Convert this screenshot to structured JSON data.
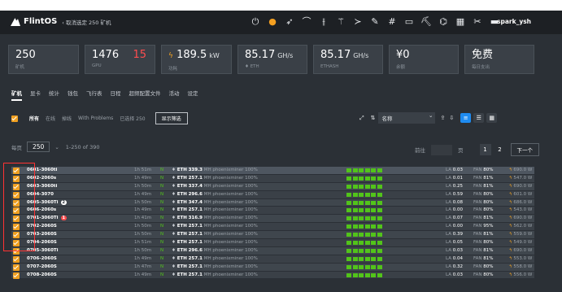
{
  "app": {
    "name": "FlintOS",
    "back": "‹ 取消选定 250 矿机",
    "user": "spark_ysh"
  },
  "topbar_icons": [
    "power-icon",
    "orange-icon",
    "rocket-icon",
    "gauge-icon",
    "sliders-icon",
    "wand-icon",
    "terminal-icon",
    "brush-icon",
    "hash-icon",
    "monitor-icon",
    "pick-icon",
    "usb-icon",
    "chip-icon",
    "tools-icon",
    "minus-box-icon"
  ],
  "stats": [
    {
      "value": "250",
      "label": "矿机",
      "unit": "",
      "extra": ""
    },
    {
      "value": "1476",
      "label": "GPU",
      "unit": "",
      "extra": "15"
    },
    {
      "value": "189.5",
      "label": "功耗",
      "unit": "kW",
      "extra": ""
    },
    {
      "value": "85.17",
      "label": "ETH",
      "unit": "GH/s",
      "extra": ""
    },
    {
      "value": "85.17",
      "label": "ETHASH",
      "unit": "GH/s",
      "extra": ""
    },
    {
      "value": "¥0",
      "label": "余额",
      "unit": "",
      "extra": ""
    },
    {
      "value": "免费",
      "label": "每日支出",
      "unit": "",
      "extra": ""
    }
  ],
  "tabs": [
    "矿机",
    "显卡",
    "统计",
    "钱包",
    "飞行表",
    "日程",
    "超频配置文件",
    "活动",
    "设定"
  ],
  "filters": {
    "all": "所有",
    "online": "在线",
    "offline": "掉线",
    "problems": "With Problems",
    "selected": "已选择 250",
    "show_button": "显示筛选"
  },
  "sort": {
    "value": "名称"
  },
  "pager": {
    "per_page_label": "每页",
    "per_page": "250",
    "range": "1-250 of 390",
    "goto": "前往",
    "page_suffix": "页",
    "pages": [
      "1",
      "2"
    ],
    "next": "下一个"
  },
  "rows": [
    {
      "name": "0601-3060ti",
      "badge": "",
      "uptime": "1h 51m",
      "status": "N",
      "coin": "ETH",
      "hashrate": "339.3",
      "unit": "MH",
      "miner": "phoenixminer",
      "pct": "100%",
      "la": "0.03",
      "fan": "80%",
      "power": "690.0 W"
    },
    {
      "name": "0602-2060s",
      "badge": "",
      "uptime": "1h 49m",
      "status": "N",
      "coin": "ETH",
      "hashrate": "257.1",
      "unit": "MH",
      "miner": "phoenixminer",
      "pct": "100%",
      "la": "0.01",
      "fan": "81%",
      "power": "547.0 W"
    },
    {
      "name": "0603-3060ti",
      "badge": "",
      "uptime": "1h 50m",
      "status": "N",
      "coin": "ETH",
      "hashrate": "337.4",
      "unit": "MH",
      "miner": "phoenixminer",
      "pct": "100%",
      "la": "0.25",
      "fan": "81%",
      "power": "690.0 W"
    },
    {
      "name": "0604-3070",
      "badge": "",
      "uptime": "1h 49m",
      "status": "N",
      "coin": "ETH",
      "hashrate": "296.6",
      "unit": "MH",
      "miner": "phoenixminer",
      "pct": "100%",
      "la": "0.59",
      "fan": "80%",
      "power": "601.0 W"
    },
    {
      "name": "0605-3060Ti",
      "badge": "2",
      "uptime": "1h 50m",
      "status": "N",
      "coin": "ETH",
      "hashrate": "347.4",
      "unit": "MH",
      "miner": "phoenixminer",
      "pct": "100%",
      "la": "0.08",
      "fan": "80%",
      "power": "686.0 W"
    },
    {
      "name": "0606-2060s",
      "badge": "",
      "uptime": "1h 49m",
      "status": "N",
      "coin": "ETH",
      "hashrate": "257.1",
      "unit": "MH",
      "miner": "phoenixminer",
      "pct": "100%",
      "la": "0.00",
      "fan": "80%",
      "power": "543.0 W"
    },
    {
      "name": "0701-3060Ti",
      "badge": "1",
      "uptime": "1h 41m",
      "status": "N",
      "coin": "ETH",
      "hashrate": "316.9",
      "unit": "MH",
      "miner": "phoenixminer",
      "pct": "100%",
      "la": "0.07",
      "fan": "81%",
      "power": "690.0 W"
    },
    {
      "name": "0702-2060S",
      "badge": "",
      "uptime": "1h 50m",
      "status": "N",
      "coin": "ETH",
      "hashrate": "257.1",
      "unit": "MH",
      "miner": "phoenixminer",
      "pct": "100%",
      "la": "0.00",
      "fan": "95%",
      "power": "562.0 W"
    },
    {
      "name": "0703-2060S",
      "badge": "",
      "uptime": "1h 50m",
      "status": "N",
      "coin": "ETH",
      "hashrate": "257.1",
      "unit": "MH",
      "miner": "phoenixminer",
      "pct": "100%",
      "la": "0.39",
      "fan": "81%",
      "power": "559.0 W"
    },
    {
      "name": "0704-2060S",
      "badge": "",
      "uptime": "1h 51m",
      "status": "N",
      "coin": "ETH",
      "hashrate": "257.1",
      "unit": "MH",
      "miner": "phoenixminer",
      "pct": "100%",
      "la": "0.05",
      "fan": "80%",
      "power": "549.0 W"
    },
    {
      "name": "0705-3060Ti",
      "badge": "",
      "uptime": "1h 50m",
      "status": "N",
      "coin": "ETH",
      "hashrate": "296.6",
      "unit": "MH",
      "miner": "phoenixminer",
      "pct": "100%",
      "la": "0.03",
      "fan": "81%",
      "power": "690.0 W"
    },
    {
      "name": "0706-2060S",
      "badge": "",
      "uptime": "1h 49m",
      "status": "N",
      "coin": "ETH",
      "hashrate": "257.1",
      "unit": "MH",
      "miner": "phoenixminer",
      "pct": "100%",
      "la": "0.04",
      "fan": "81%",
      "power": "553.0 W"
    },
    {
      "name": "0707-2060S",
      "badge": "",
      "uptime": "1h 47m",
      "status": "N",
      "coin": "ETH",
      "hashrate": "257.1",
      "unit": "MH",
      "miner": "phoenixminer",
      "pct": "100%",
      "la": "0.32",
      "fan": "80%",
      "power": "558.0 W"
    },
    {
      "name": "0708-2060S",
      "badge": "",
      "uptime": "1h 49m",
      "status": "N",
      "coin": "ETH",
      "hashrate": "257.1",
      "unit": "MH",
      "miner": "phoenixminer",
      "pct": "100%",
      "la": "0.03",
      "fan": "80%",
      "power": "556.0 W"
    }
  ],
  "colors": {
    "bg": "#2b3036",
    "topbar": "#1d2024",
    "accent": "#f0a020",
    "ok": "#52c41a",
    "danger": "#ff4d4f",
    "primary": "#1e8bf0"
  }
}
